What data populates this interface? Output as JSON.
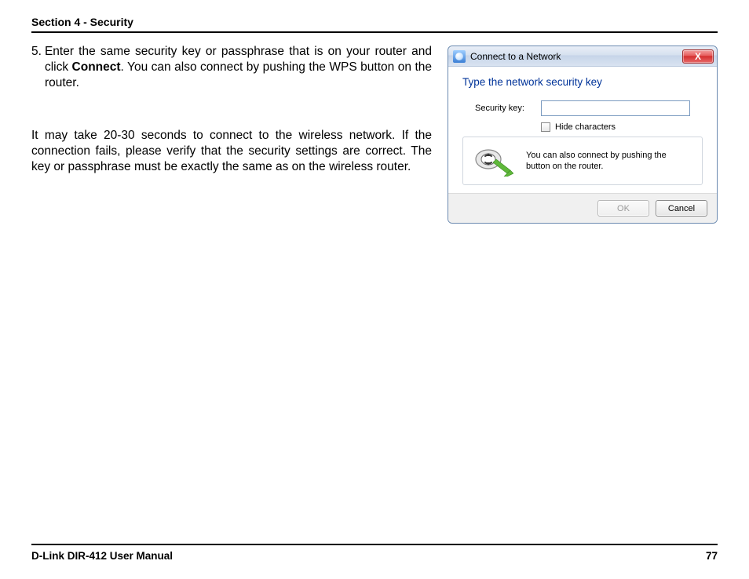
{
  "header": {
    "section_label": "Section 4 - Security"
  },
  "step": {
    "number": "5.",
    "text_before_bold": "Enter the same security key or passphrase that is on your router and click ",
    "bold_word": "Connect",
    "text_after_bold": ". You can also connect by pushing the WPS button on the router."
  },
  "note": "It may take 20-30 seconds to connect to the wireless network. If the connection fails, please verify that the security settings are correct. The key or passphrase must be exactly the same as on the wireless router.",
  "dialog": {
    "title": "Connect to a Network",
    "close_glyph": "X",
    "heading": "Type the network security key",
    "security_key_label": "Security key:",
    "security_key_value": "",
    "hide_chars_label": "Hide characters",
    "hint_text": "You can also connect by pushing the button on the router.",
    "ok_label": "OK",
    "cancel_label": "Cancel"
  },
  "footer": {
    "manual_label": "D-Link DIR-412 User Manual",
    "page_number": "77"
  }
}
